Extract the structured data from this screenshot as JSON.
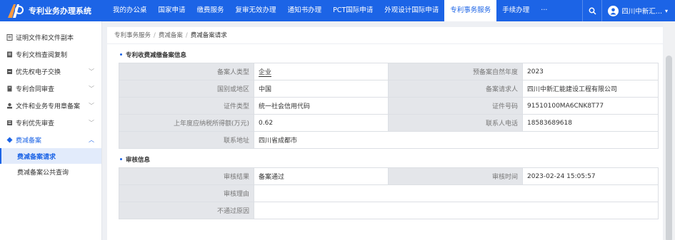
{
  "app": {
    "title": "专利业务办理系统"
  },
  "colors": {
    "primary": "#1c64e6",
    "label_bg": "#e4e6ea"
  },
  "nav": [
    {
      "label": "我的办公桌",
      "active": false
    },
    {
      "label": "国家申请",
      "active": false
    },
    {
      "label": "缴费服务",
      "active": false
    },
    {
      "label": "复审无效办理",
      "active": false
    },
    {
      "label": "通知书办理",
      "active": false
    },
    {
      "label": "PCT国际申请",
      "active": false
    },
    {
      "label": "外观设计国际申请",
      "active": false
    },
    {
      "label": "专利事务服务",
      "active": true
    },
    {
      "label": "手续办理",
      "active": false
    },
    {
      "label": "···",
      "active": false
    }
  ],
  "user": {
    "name": "四川中新汇...",
    "icon": "user-icon"
  },
  "sidebar": {
    "items": [
      {
        "label": "证明文件和文件副本",
        "icon": "certificate-icon",
        "caret": ""
      },
      {
        "label": "专利文档查阅复制",
        "icon": "document-icon",
        "caret": ""
      },
      {
        "label": "优先权电子交换",
        "icon": "exchange-icon",
        "caret": "﹀"
      },
      {
        "label": "专利合同审查",
        "icon": "contract-icon",
        "caret": "﹀"
      },
      {
        "label": "文件和业务专用章备案",
        "icon": "seal-icon",
        "caret": "﹀"
      },
      {
        "label": "专利优先审查",
        "icon": "priority-icon",
        "caret": "﹀"
      },
      {
        "label": "费减备案",
        "icon": "fee-reduction-icon",
        "caret": "︿"
      }
    ],
    "sub_items": [
      {
        "label": "费减备案请求",
        "active": true
      },
      {
        "label": "费减备案公共查询",
        "active": false
      }
    ]
  },
  "breadcrumb": [
    "专利事务服务",
    "费减备案",
    "费减备案请求"
  ],
  "section1": {
    "title": "专利收费减缴备案信息",
    "rows": [
      {
        "l1": "备案人类型",
        "v1": "企业",
        "l2": "预备案自然年度",
        "v2": "2023"
      },
      {
        "l1": "国别或地区",
        "v1": "中国",
        "l2": "备案请求人",
        "v2": "四川中新汇能建设工程有限公司"
      },
      {
        "l1": "证件类型",
        "v1": "统一社会信用代码",
        "l2": "证件号码",
        "v2": "91510100MA6CNK8T77"
      },
      {
        "l1": "上年度应纳税所得额(万元)",
        "v1": "0.62",
        "l2": "联系人电话",
        "v2": "18583689618"
      }
    ],
    "address": {
      "label": "联系地址",
      "value": "四川省成都市"
    }
  },
  "section2": {
    "title": "审核信息",
    "result_label": "审核结果",
    "result_value": "备案通过",
    "time_label": "审核时间",
    "time_value": "2023-02-24 15:05:57",
    "reason_label": "审核理由",
    "reason_value": "",
    "fail_label": "不通过原因",
    "fail_value": ""
  }
}
